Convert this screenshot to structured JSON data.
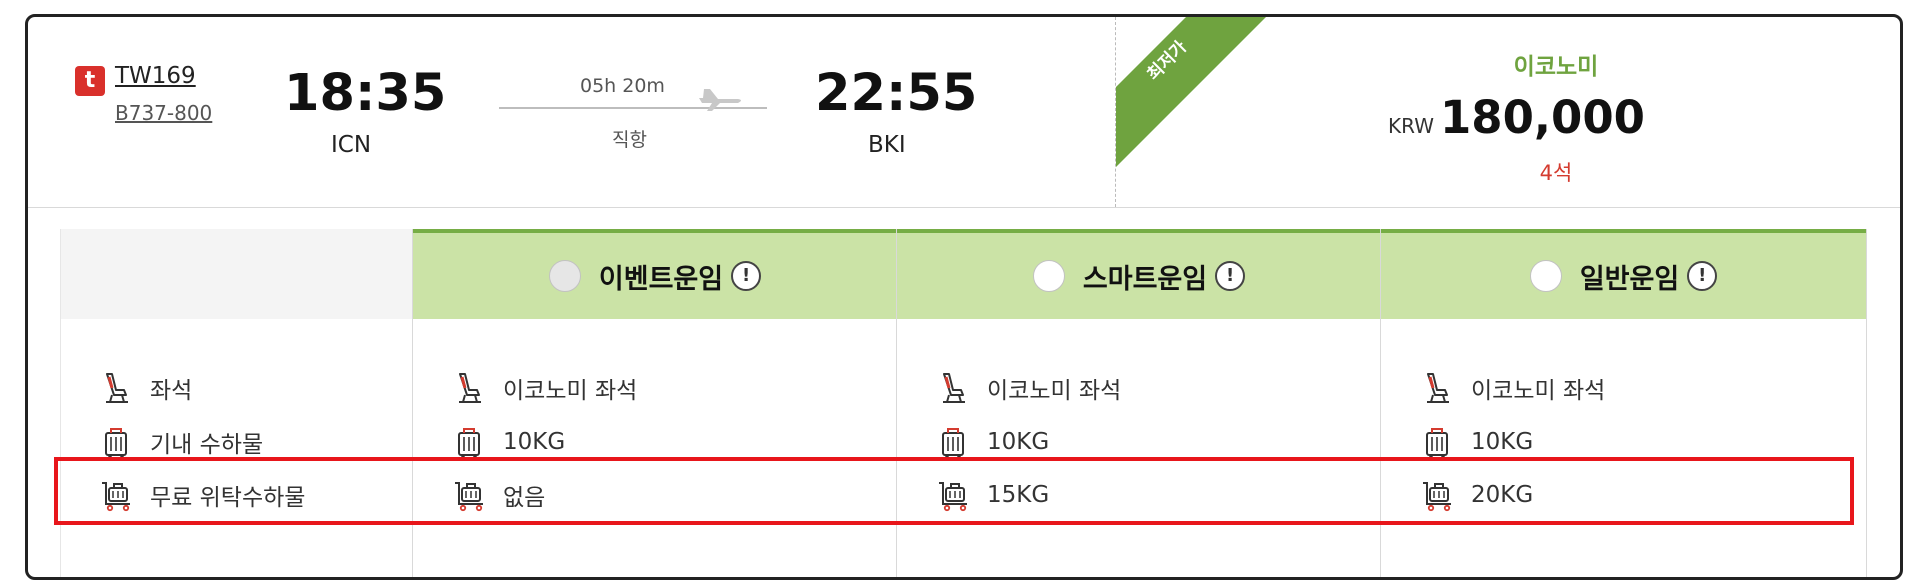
{
  "flight": {
    "airline_logo_letter": "t",
    "flight_number": "TW169",
    "aircraft": "B737-800",
    "departure": {
      "time": "18:35",
      "airport": "ICN"
    },
    "arrival": {
      "time": "22:55",
      "airport": "BKI"
    },
    "duration": "05h 20m",
    "stops": "직항"
  },
  "badge": {
    "label": "최저가",
    "color": "#6fa33f"
  },
  "price": {
    "cabin": "이코노미",
    "currency": "KRW",
    "amount": "180,000",
    "seats_left": "4석"
  },
  "table": {
    "labels": {
      "seat": "좌석",
      "carry_on": "기내 수하물",
      "checked": "무료 위탁수하물"
    },
    "fares": [
      {
        "name": "이벤트운임",
        "info": "!",
        "seat": "이코노미 좌석",
        "carry_on": "10KG",
        "checked": "없음",
        "selectable": false
      },
      {
        "name": "스마트운임",
        "info": "!",
        "seat": "이코노미 좌석",
        "carry_on": "10KG",
        "checked": "15KG",
        "selectable": true
      },
      {
        "name": "일반운임",
        "info": "!",
        "seat": "이코노미 좌석",
        "carry_on": "10KG",
        "checked": "20KG",
        "selectable": true
      }
    ]
  },
  "icons": {
    "seat": "seat-icon",
    "carry_on": "luggage-icon",
    "checked": "baggage-cart-icon",
    "plane": "plane-icon"
  },
  "colors": {
    "accent_green": "#76ad45",
    "header_green": "#cbe3a6",
    "seat_red": "#d43b2f",
    "highlight_red": "#e8161b"
  }
}
